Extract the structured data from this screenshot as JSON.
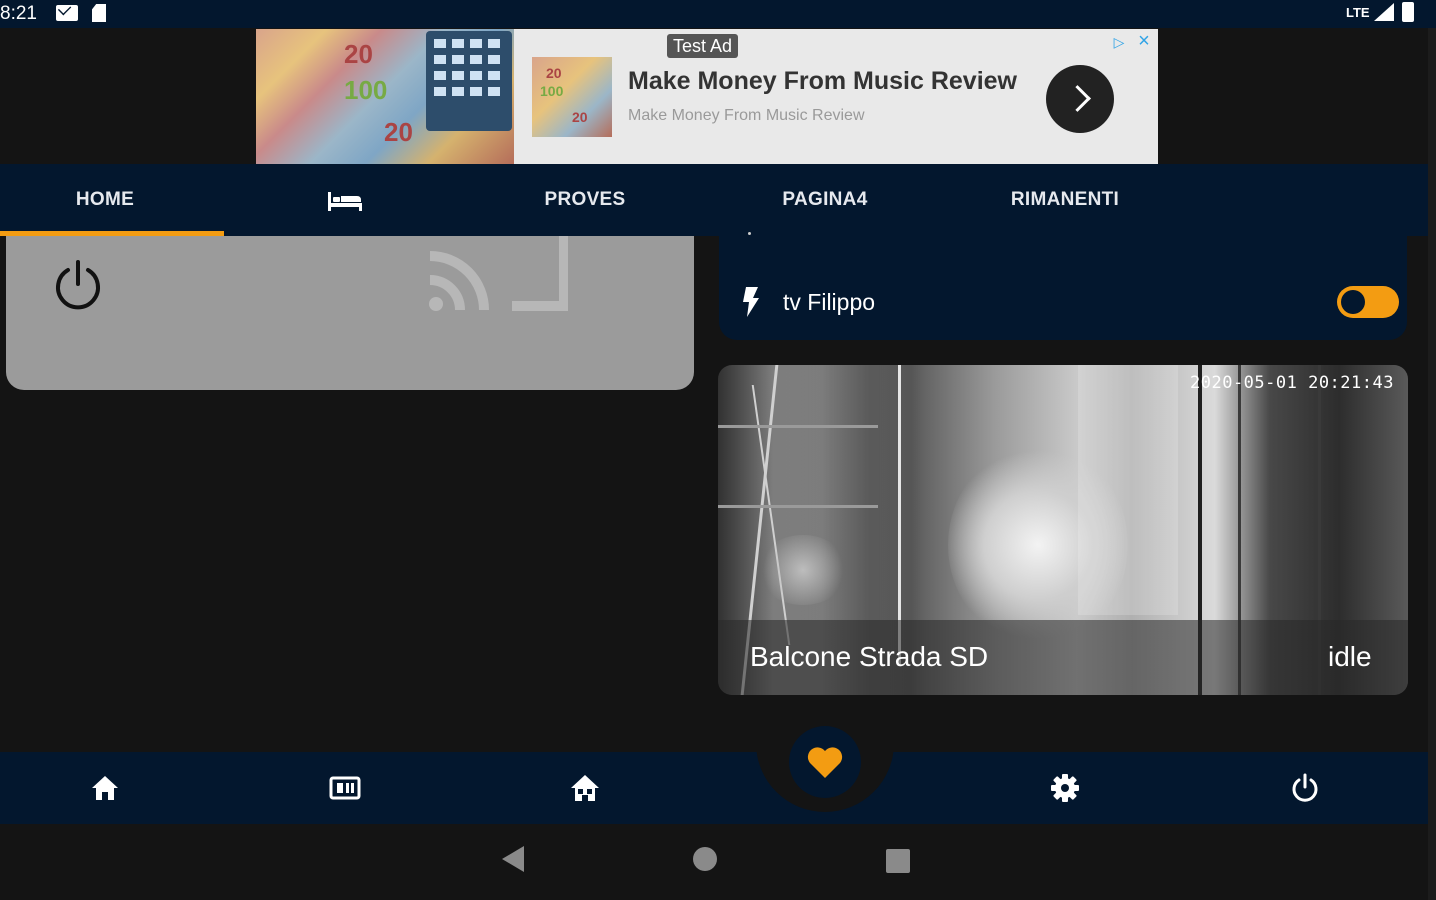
{
  "status_bar": {
    "time": "8:21",
    "network": "LTE",
    "icons": [
      "mail-icon",
      "sd-card-icon",
      "signal-icon",
      "battery-icon"
    ]
  },
  "ad": {
    "label": "Test Ad",
    "headline": "Make Money From Music Review",
    "subline": "Make Money From Music Review",
    "adchoices_icon": "adchoices-icon",
    "close_icon": "close-icon",
    "image_notes": [
      "20",
      "100",
      "20"
    ],
    "thumb_notes": [
      "20",
      "100",
      "20"
    ]
  },
  "tabs": [
    {
      "label": "HOME",
      "active": true
    },
    {
      "label": "",
      "icon": "bed-icon",
      "active": false
    },
    {
      "label": "PROVES",
      "active": false
    },
    {
      "label": "PAGINA4",
      "active": false
    },
    {
      "label": "RIMANENTI",
      "active": false
    }
  ],
  "switch_card": {
    "label": "tv Filippo",
    "icon": "flash-icon",
    "state": "on"
  },
  "camera": {
    "name": "Balcone Strada SD",
    "state": "idle",
    "timestamp": "2020-05-01 20:21:43"
  },
  "bottom_nav": {
    "items": [
      "home-icon",
      "dashboard-icon",
      "house-group-icon",
      "favorites-heart-icon",
      "settings-gear-icon",
      "power-icon"
    ]
  },
  "colors": {
    "navy": "#03172e",
    "accent": "#f39c12",
    "background": "#141414",
    "card_grey": "#9b9b9b"
  }
}
